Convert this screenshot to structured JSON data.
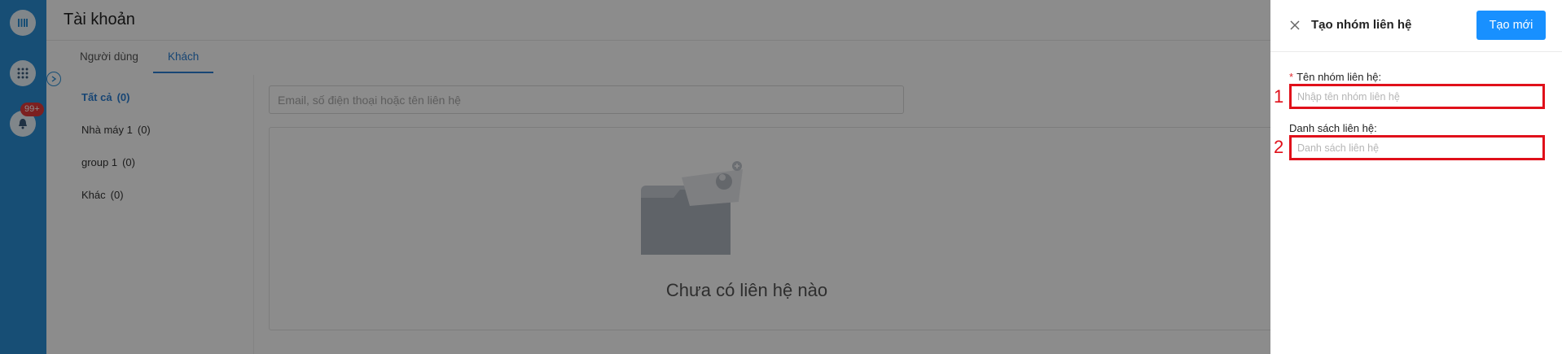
{
  "rail": {
    "badge": "99+",
    "icons": [
      "logo-icon",
      "apps-grid-icon",
      "bell-icon"
    ]
  },
  "page": {
    "title": "Tài khoản",
    "tabs": [
      {
        "label": "Người dùng",
        "active": false
      },
      {
        "label": "Khách",
        "active": true
      }
    ],
    "categories": [
      {
        "name": "Tất cả",
        "count": "(0)",
        "active": true
      },
      {
        "name": "Nhà máy 1",
        "count": "(0)",
        "active": false
      },
      {
        "name": "group 1",
        "count": "(0)",
        "active": false
      },
      {
        "name": "Khác",
        "count": "(0)",
        "active": false
      }
    ],
    "search_placeholder": "Email, số điện thoại hoặc tên liên hệ",
    "empty_text": "Chưa có liên hệ nào"
  },
  "drawer": {
    "title": "Tạo nhóm liên hệ",
    "create_label": "Tạo mới",
    "fields": [
      {
        "marker": "1",
        "required": true,
        "label": "Tên nhóm liên hệ:",
        "placeholder": "Nhập tên nhóm liên hệ"
      },
      {
        "marker": "2",
        "required": false,
        "label": "Danh sách liên hệ:",
        "placeholder": "Danh sách liên hệ"
      }
    ]
  },
  "colors": {
    "rail": "#2a8fd6",
    "accent": "#1890ff",
    "highlight": "#e0101a"
  }
}
